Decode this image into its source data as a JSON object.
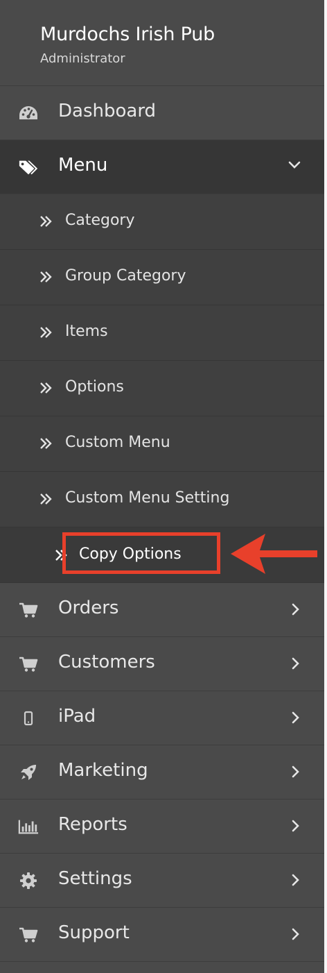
{
  "header": {
    "title": "Murdochs Irish Pub",
    "subtitle": "Administrator"
  },
  "nav": [
    {
      "id": "dashboard",
      "label": "Dashboard",
      "icon": "dashboard-gauge-icon"
    },
    {
      "id": "menu",
      "label": "Menu",
      "icon": "tags-icon",
      "expanded": true
    },
    {
      "id": "orders",
      "label": "Orders",
      "icon": "cart-icon"
    },
    {
      "id": "customers",
      "label": "Customers",
      "icon": "cart-icon"
    },
    {
      "id": "ipad",
      "label": "iPad",
      "icon": "mobile-device-icon"
    },
    {
      "id": "marketing",
      "label": "Marketing",
      "icon": "rocket-icon"
    },
    {
      "id": "reports",
      "label": "Reports",
      "icon": "bar-chart-icon"
    },
    {
      "id": "settings",
      "label": "Settings",
      "icon": "gear-icon"
    },
    {
      "id": "support",
      "label": "Support",
      "icon": "cart-icon"
    }
  ],
  "menu_sub": [
    {
      "label": "Category"
    },
    {
      "label": "Group Category"
    },
    {
      "label": "Items"
    },
    {
      "label": "Options"
    },
    {
      "label": "Custom Menu"
    },
    {
      "label": "Custom Menu Setting"
    },
    {
      "label": "Copy Options",
      "highlighted": true
    }
  ],
  "colors": {
    "sidebar_bg": "#4a4a4a",
    "active_bg": "#363636",
    "submenu_bg": "#404040",
    "annotation_red": "#e8402b"
  }
}
